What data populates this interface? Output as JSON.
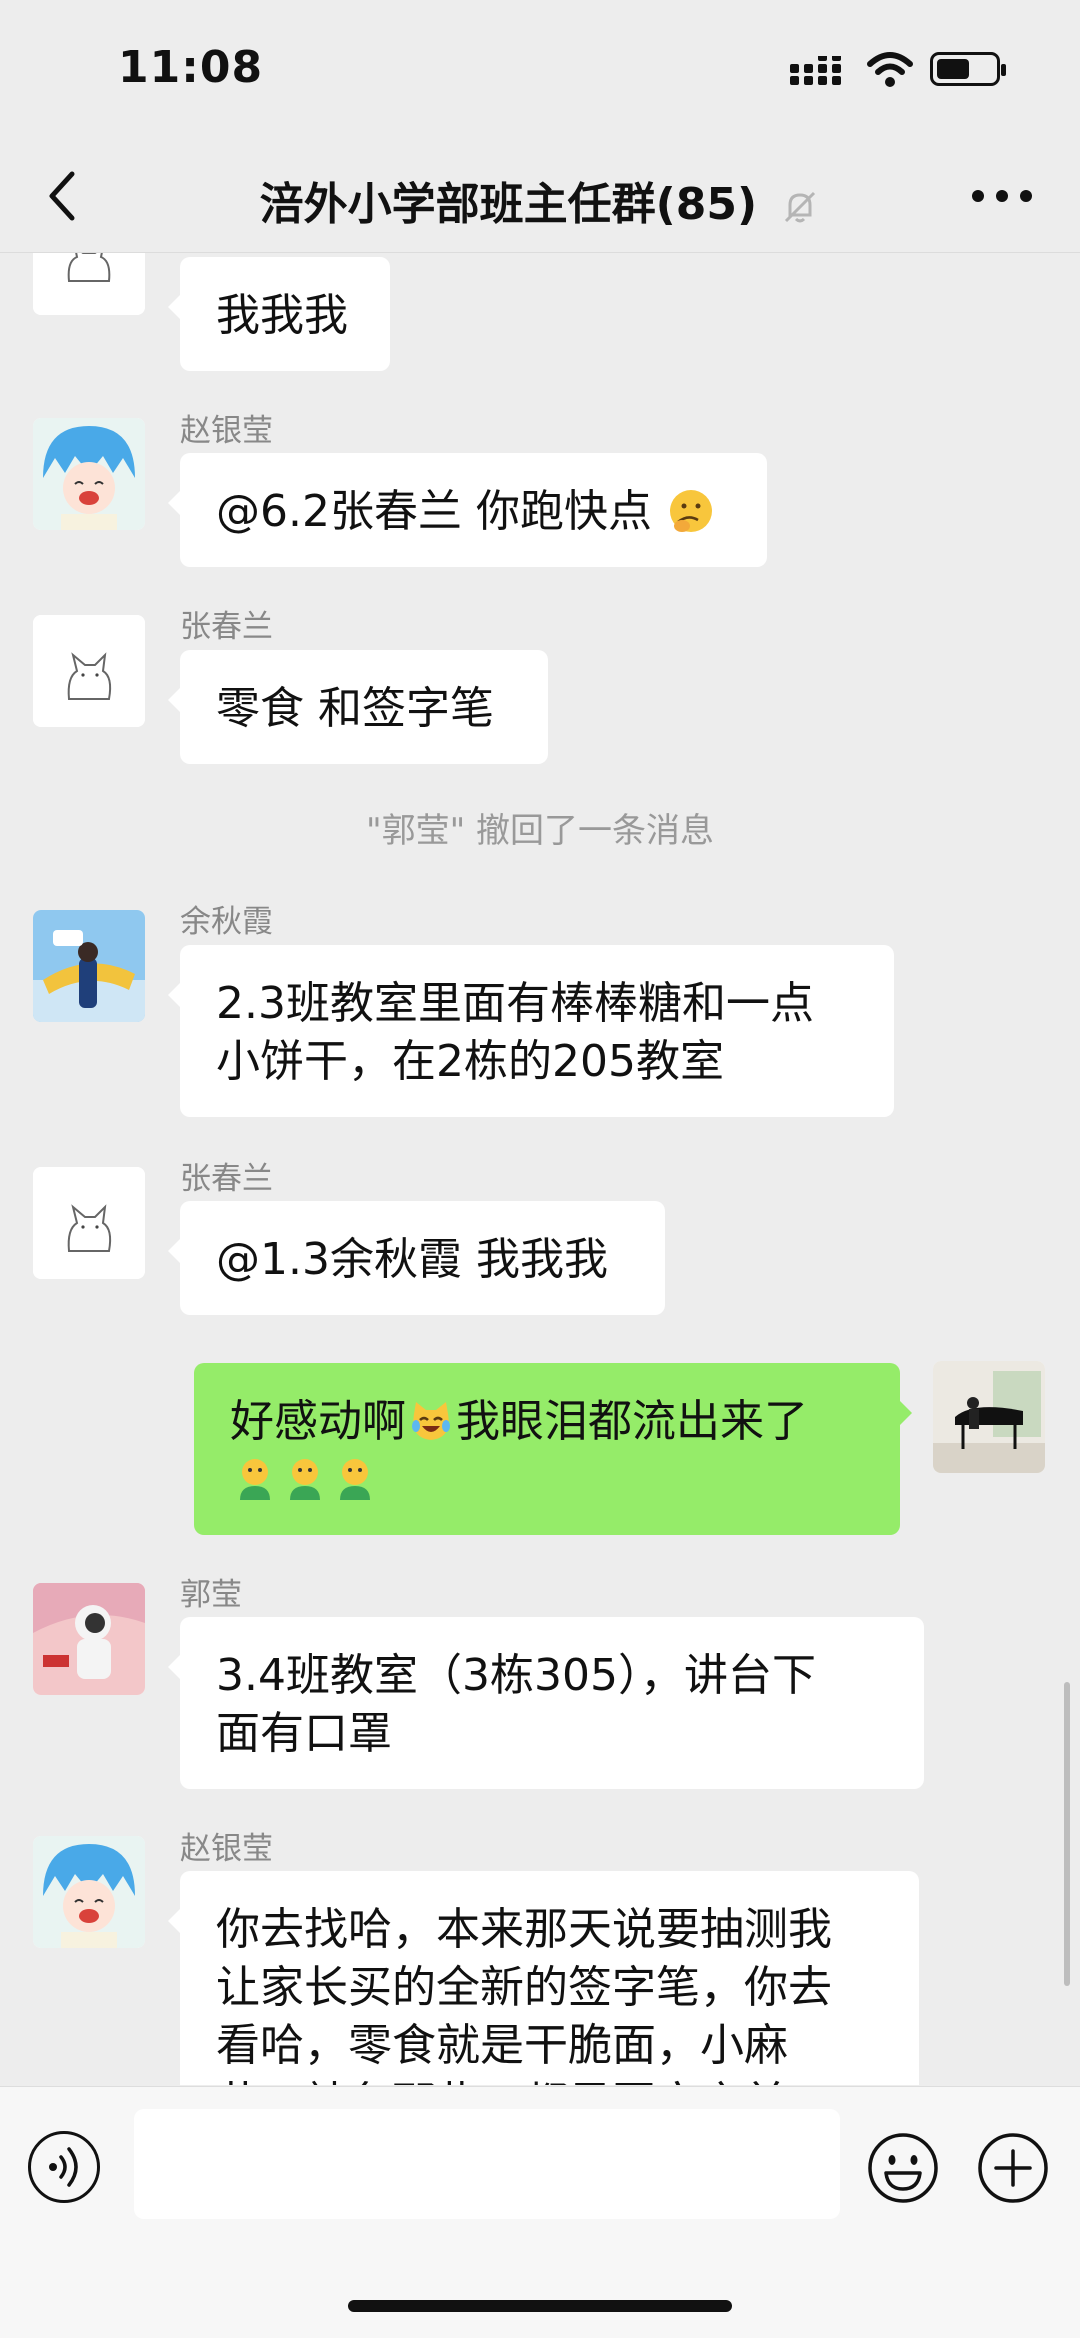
{
  "status_bar": {
    "time": "11:08"
  },
  "header": {
    "title": "涪外小学部班主任群(85)"
  },
  "messages": [
    {
      "sender": "",
      "text": "我我我"
    },
    {
      "sender": "赵银莹",
      "text": "@6.2张春兰 你跑快点"
    },
    {
      "sender": "张春兰",
      "text": "零食 和签字笔"
    },
    {
      "system": "\"郭莹\" 撤回了一条消息"
    },
    {
      "sender": "余秋霞",
      "lines": [
        "2.3班教室里面有棒棒糖和一点",
        "小饼干，在2栋的205教室"
      ]
    },
    {
      "sender": "张春兰",
      "text": "@1.3余秋霞 我我我"
    },
    {
      "sender": "me",
      "text": "好感动啊",
      "text2": "我眼泪都流出来了"
    },
    {
      "sender": "郭莹",
      "lines": [
        "3.4班教室（3栋305），讲台下",
        "面有口罩"
      ]
    },
    {
      "sender": "赵银莹",
      "lines": [
        "你去找哈，本来那天说要抽测我",
        "让家长买的全新的签字笔，你去",
        "看哈，零食就是干脆面，小麻",
        "花，辣条那些，都是回家之前"
      ]
    }
  ],
  "input": {
    "placeholder": ""
  },
  "colors": {
    "bg": "#ededed",
    "bubble_self": "#95ec69",
    "bubble_other": "#ffffff"
  }
}
